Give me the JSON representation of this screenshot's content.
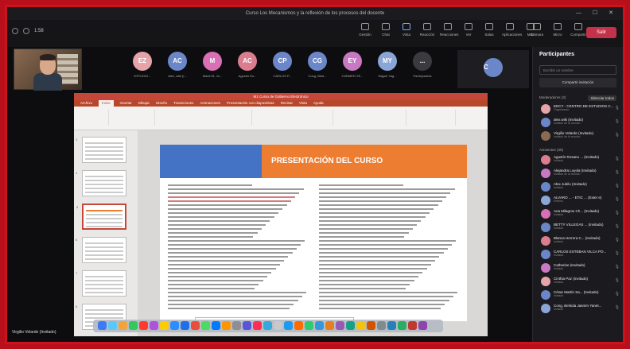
{
  "window": {
    "title": "Curso Los Mecanismos y la reflexión de los procesos del docente",
    "controls": "— ☐ ✕"
  },
  "toolbar": {
    "time": "1:58",
    "tools": [
      {
        "label": "Gestión",
        "active": false
      },
      {
        "label": "Chat",
        "active": false
      },
      {
        "label": "Vista",
        "active": true
      },
      {
        "label": "Reacción",
        "active": false
      },
      {
        "label": "Reacciones",
        "active": false
      },
      {
        "label": "Ver",
        "active": false
      },
      {
        "label": "Salas",
        "active": false
      },
      {
        "label": "Aplicaciones",
        "active": false
      },
      {
        "label": "Más",
        "active": false
      }
    ],
    "right_tools": [
      "Cámara",
      "Micro",
      "Compartir"
    ],
    "leave_label": "Salir"
  },
  "video": {
    "tiles": [
      {
        "initials": "EZ",
        "color": "#e6a3a8",
        "name": "ESTUDIO..."
      },
      {
        "initials": "AC",
        "color": "#6b87c9",
        "name": "Alex, wiki (I..."
      },
      {
        "initials": "M",
        "color": "#d96fb4",
        "name": "Mariel B. Ju..."
      },
      {
        "initials": "AC",
        "color": "#dc7d8f",
        "name": "Agustín Es..."
      },
      {
        "initials": "CP",
        "color": "#6b87c9",
        "name": "CARLOS P..."
      },
      {
        "initials": "CG",
        "color": "#6b87c9",
        "name": "Cong, Bela..."
      },
      {
        "initials": "EY",
        "color": "#c979c4",
        "name": "CARMEN YE..."
      },
      {
        "initials": "MY",
        "color": "#8aa6d6",
        "name": "Miguel Yag..."
      },
      {
        "initials": "...",
        "color": "#3a3a3f",
        "name": "Participantes"
      }
    ],
    "more": {
      "initials": "C",
      "color": "#6b87c9"
    }
  },
  "ppt": {
    "title": "M1 Curso de Gobierno Electrónico",
    "menu": [
      "Archivo",
      "Inicio",
      "Insertar",
      "Dibujar",
      "Diseño",
      "Transiciones",
      "Animaciones",
      "Presentación con diapositivas",
      "Revisar",
      "Vista",
      "Ayuda"
    ],
    "active_menu": "Inicio",
    "thumb_numbers": [
      "3",
      "4",
      "5",
      "6",
      "7",
      "8"
    ],
    "slide_title": "PRESENTACIÓN DEL CURSO",
    "popup_text": "Se está compartiendo su pantalla   Dejar de compartir"
  },
  "host_name": "Virgilio Velarde (Invitado)",
  "participants": {
    "title": "Participantes",
    "search_placeholder": "Escribir un nombre",
    "invite_label": "Compartir invitación",
    "hosts_label": "Moderadores (3)",
    "mute_all_label": "Silenciar todos",
    "attendees_label": "Asistentes (39)",
    "list": [
      {
        "name": "EDCY - CENTRO DE ESTUDIOS C...",
        "status": "Organizador",
        "color": "#e6a3a8"
      },
      {
        "name": "alex.wiki (Invitado)",
        "status": "Invitado de la reunión",
        "color": "#6b87c9"
      },
      {
        "name": "Virgilio Velarde (Invitado)",
        "status": "Invitado de la reunión",
        "color": "#8a6a50"
      },
      {
        "name": "Agustín Rosano ... (Invitado)",
        "status": "Invitado",
        "color": "#dc7d8f"
      },
      {
        "name": "Alejandra Loyola (Invitado)",
        "status": "Invitado de la reunión",
        "color": "#c979c4"
      },
      {
        "name": "Alex Jubilo (Invitado)",
        "status": "Invitado",
        "color": "#6b87c9"
      },
      {
        "name": "ALVARO ... - ETIC ... (Exter e)",
        "status": "Externo",
        "color": "#8aa6d6"
      },
      {
        "name": "Ana Milagros Ch... (Invitado)",
        "status": "Invitado",
        "color": "#d96fb4"
      },
      {
        "name": "BETTY VILLEGAS ... (Invitado)",
        "status": "Invitado",
        "color": "#6b87c9"
      },
      {
        "name": "Blanca Herrera C... (Invitado)",
        "status": "Invitado",
        "color": "#dc7d8f"
      },
      {
        "name": "CARLOS ESTEBAN VILCA PO...",
        "status": "Invitado",
        "color": "#6b87c9"
      },
      {
        "name": "Catherine (Invitado)",
        "status": "Invitado",
        "color": "#c979c4"
      },
      {
        "name": "Cinthia Paz (Invitado)",
        "status": "Invitado",
        "color": "#e6a3a8"
      },
      {
        "name": "César Martín Sa... (Invitado)",
        "status": "Invitado",
        "color": "#6b87c9"
      },
      {
        "name": "Cong, Belinda Jasmín Yanet...",
        "status": "Invitado",
        "color": "#8aa6d6"
      }
    ]
  }
}
